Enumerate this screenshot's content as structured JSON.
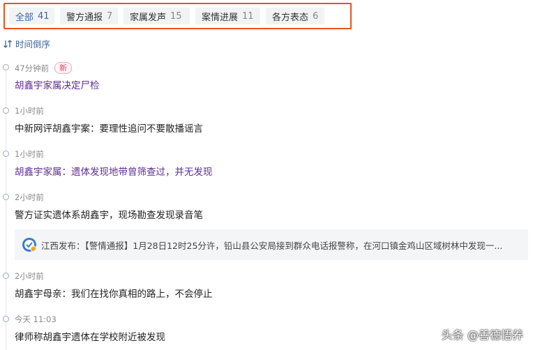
{
  "tabs": [
    {
      "label": "全部",
      "count": "41"
    },
    {
      "label": "警方通报",
      "count": "7"
    },
    {
      "label": "家属发声",
      "count": "15"
    },
    {
      "label": "案情进展",
      "count": "11"
    },
    {
      "label": "各方表态",
      "count": "6"
    }
  ],
  "sort": {
    "label": "时间倒序"
  },
  "items": [
    {
      "time": "47分钟前",
      "badge": "新",
      "title": "胡鑫宇家属决定尸检"
    },
    {
      "time": "1小时前",
      "title": "中新网评胡鑫宇案：要理性追问不要散播谣言"
    },
    {
      "time": "1小时前",
      "title": "胡鑫宇家属：遗体发现地带曾筛查过，并无发现"
    },
    {
      "time": "2小时前",
      "title": "警方证实遗体系胡鑫宇，现场勘查发现录音笔"
    },
    {
      "time": "2小时前",
      "title": "胡鑫宇母亲：我们在找你真相的路上，不会停止"
    },
    {
      "time": "今天 11:03",
      "title": "律师称胡鑫宇遗体在学校附近被发现"
    }
  ],
  "quote": {
    "text": "江西发布：【警情通报】1月28日12时25分许，铅山县公安局接到群众电话报警称，在河口镇金鸡山区域树林中发现一..."
  },
  "watermark": "头条 @善德悟养",
  "colors": {
    "accent": "#406599",
    "highlight_border": "#e8531f",
    "visited": "#5e2d91",
    "badge": "#e0436a"
  }
}
